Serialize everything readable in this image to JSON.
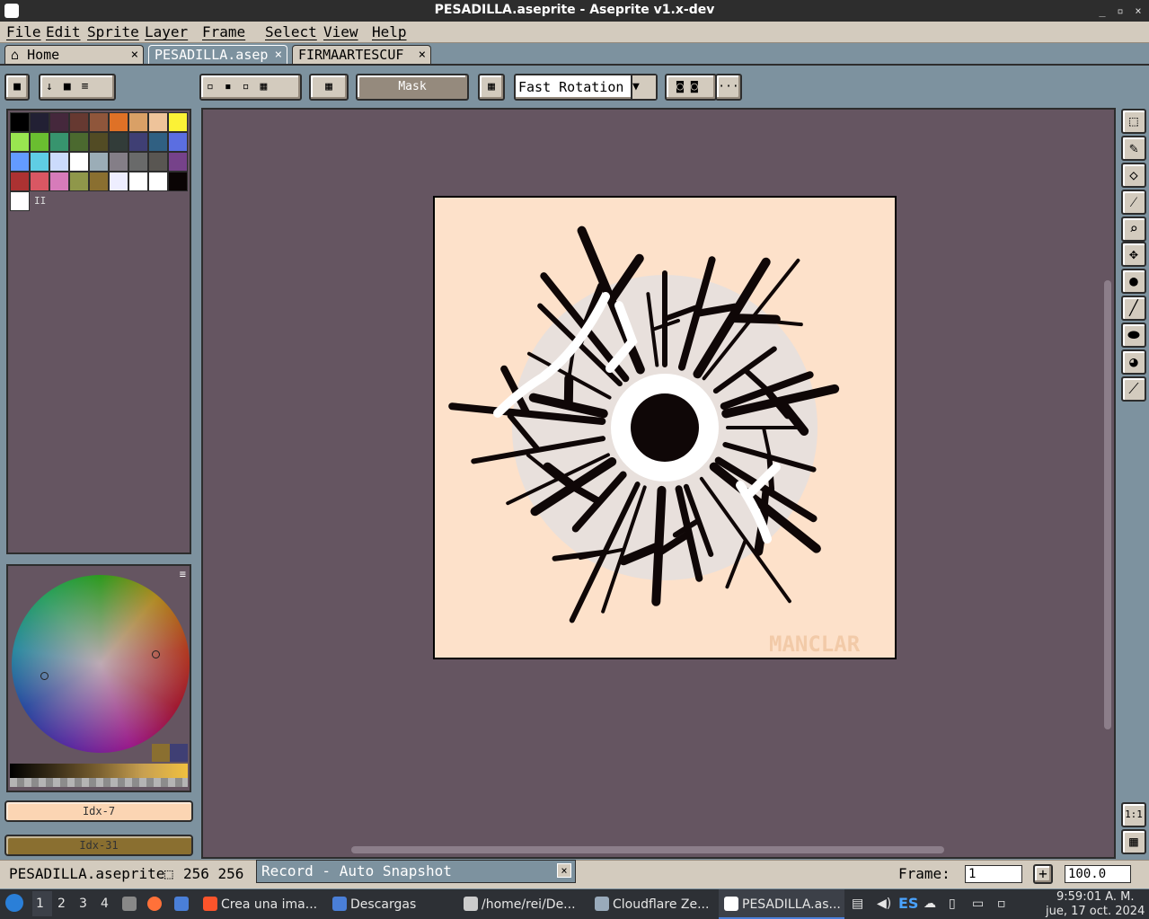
{
  "window": {
    "title": "PESADILLA.aseprite - Aseprite v1.x-dev",
    "controls": [
      "_",
      "▫",
      "×"
    ]
  },
  "menu": [
    "File",
    "Edit",
    "Sprite",
    "Layer",
    "Frame",
    "Select",
    "View",
    "Help"
  ],
  "tabs": [
    {
      "label": "Home",
      "close": "×"
    },
    {
      "label": "PESADILLA.asep",
      "close": "×"
    },
    {
      "label": "FIRMAARTESCUF",
      "close": "×"
    }
  ],
  "toolbar": {
    "mask_label": "Mask",
    "rotation_algorithm": "Fast Rotation",
    "more": "···"
  },
  "palette": {
    "colors": [
      "#000000",
      "#222034",
      "#45283c",
      "#663931",
      "#8f563b",
      "#df7126",
      "#d9a066",
      "#eec39a",
      "#fbf236",
      "#99e550",
      "#6abe30",
      "#37946e",
      "#4b692f",
      "#524b24",
      "#323c39",
      "#3f3f74",
      "#306082",
      "#5b6ee1",
      "#639bff",
      "#5fcde4",
      "#cbdbfc",
      "#ffffff",
      "#9badb7",
      "#847e87",
      "#696a6a",
      "#595652",
      "#76428a",
      "#ac3232",
      "#d95763",
      "#d77bba",
      "#8f974a",
      "#8a6f30",
      "#eeeeff",
      "#ffffff",
      "#ffffff",
      "#0a0404",
      "#ffffff"
    ],
    "count_marker": "II"
  },
  "colors": {
    "foreground_label": "Idx-7",
    "foreground": "#fbd5b3",
    "background_label": "Idx-31",
    "background": "#8a6f30"
  },
  "sprite": {
    "watermark": "MANCLAR"
  },
  "status": {
    "filename": "PESADILLA.aseprite",
    "size": "256 256",
    "record": "Record - Auto Snapshot",
    "frame_label": "Frame:",
    "frame_value": "1",
    "zoom": "100.0"
  },
  "taskbar": {
    "workspaces": [
      "1",
      "2",
      "3",
      "4"
    ],
    "tasks": [
      {
        "label": "Crea una ima...",
        "color": "#fb542b"
      },
      {
        "label": "Descargas",
        "color": "#4a7fd8"
      },
      {
        "label": "/home/rei/De...",
        "color": "#e6e6e6"
      },
      {
        "label": "Cloudflare Ze...",
        "color": "#9ab"
      },
      {
        "label": "PESADILLA.as...",
        "color": "#fff"
      }
    ],
    "keyboard": "ES",
    "time": "9:59:01 A. M.",
    "date": "jue, 17 oct. 2024"
  }
}
